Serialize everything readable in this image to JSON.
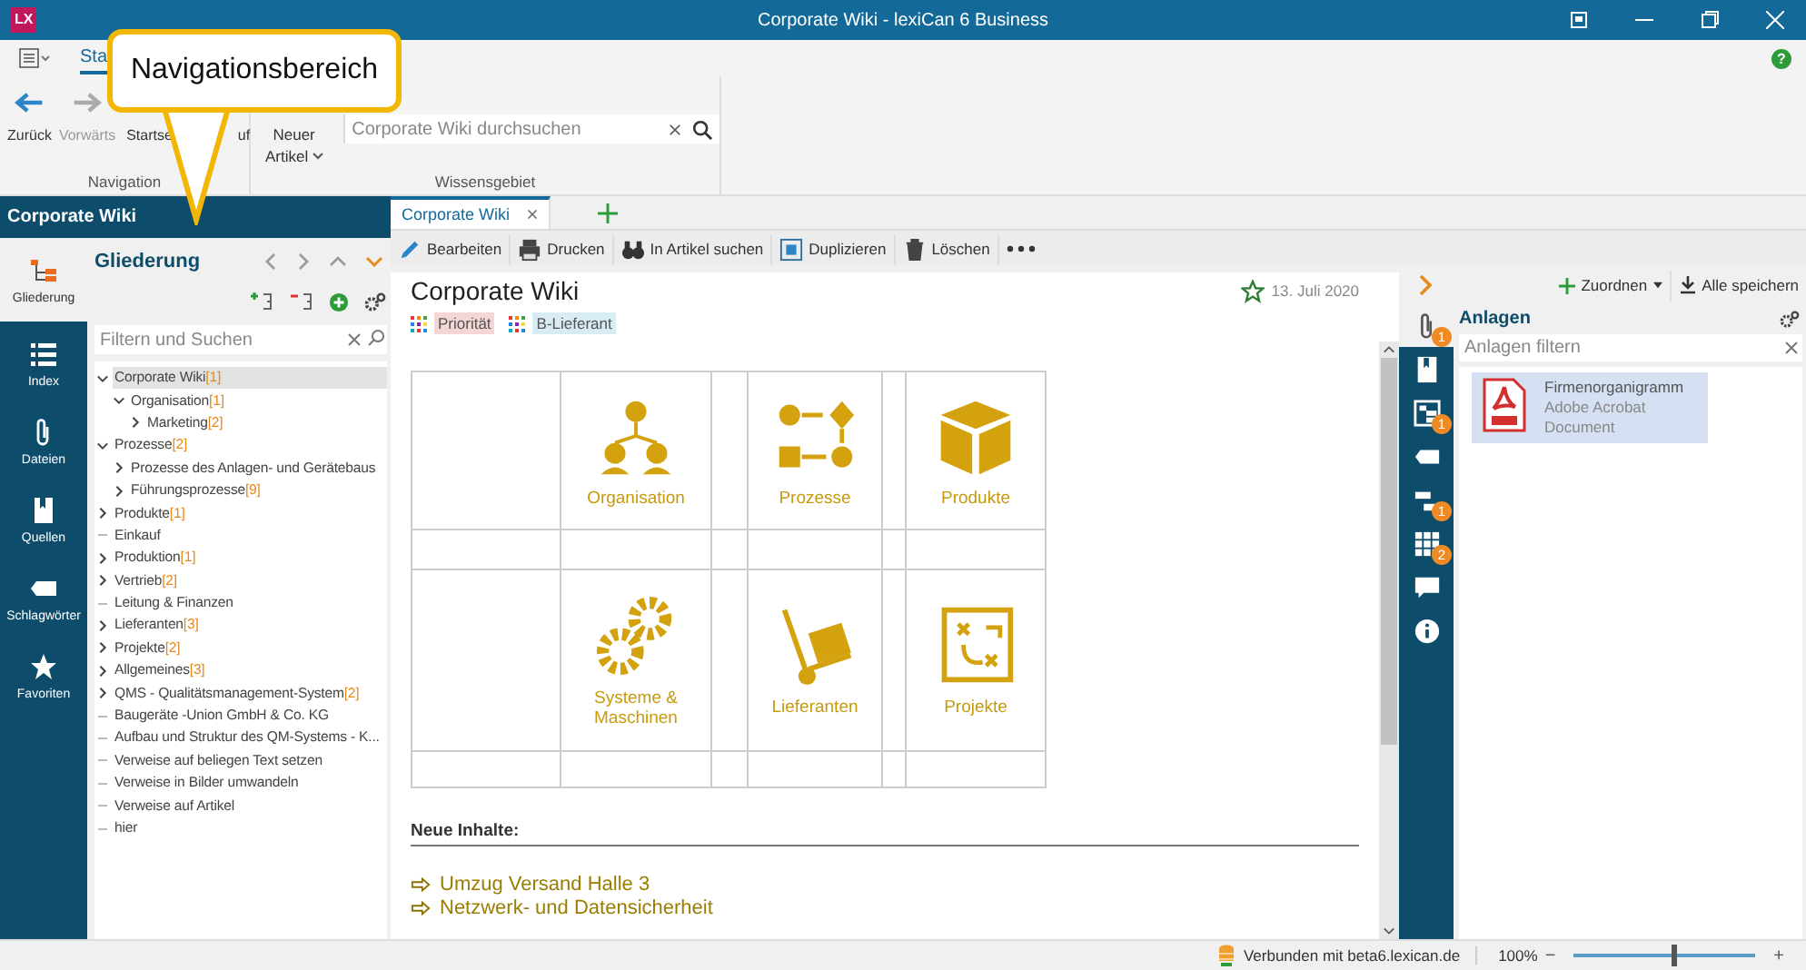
{
  "window": {
    "logo": "LX",
    "title": "Corporate Wiki - lexiCan 6 Business"
  },
  "ribbon": {
    "tabs": [
      {
        "label": "Sta",
        "selected": true
      }
    ],
    "nav_buttons": [
      {
        "kind": "back",
        "label": "Zurück",
        "disabled": false
      },
      {
        "kind": "forward",
        "label": "Vorwärts",
        "disabled": true
      },
      {
        "kind": "home",
        "label": "Startse",
        "disabled": false
      },
      {
        "kind": "history",
        "label": "uf",
        "disabled": false
      }
    ],
    "new_article": {
      "line1": "Neuer",
      "line2": "Artikel"
    },
    "search": {
      "placeholder": "Corporate Wiki durchsuchen"
    },
    "group_labels": [
      "Navigation",
      "Wissensgebiet"
    ],
    "help": "?"
  },
  "callout": {
    "text": "Navigationsbereich"
  },
  "left_panel": {
    "title": "Corporate Wiki",
    "nav": [
      {
        "kind": "outline",
        "label": "Gliederung",
        "selected": true
      },
      {
        "kind": "index",
        "label": "Index",
        "selected": false
      },
      {
        "kind": "files",
        "label": "Dateien",
        "selected": false
      },
      {
        "kind": "sources",
        "label": "Quellen",
        "selected": false
      },
      {
        "kind": "tags",
        "label": "Schlagwörter",
        "selected": false
      },
      {
        "kind": "favorites",
        "label": "Favoriten",
        "selected": false
      }
    ],
    "outline_title": "Gliederung",
    "filter": {
      "placeholder": "Filtern und Suchen"
    },
    "tree": [
      {
        "label": "Corporate Wiki",
        "count": "[1]",
        "selected": true,
        "expanded": true,
        "children": [
          {
            "label": "Organisation",
            "count": "[1]",
            "selected": false,
            "expanded": true,
            "children": [
              {
                "label": "Marketing",
                "count": "[2]",
                "selected": false,
                "expanded": false
              }
            ]
          }
        ]
      },
      {
        "label": "Prozesse",
        "count": "[2]",
        "selected": false,
        "expanded": true,
        "children": [
          {
            "label": "Prozesse des Anlagen- und Gerätebaus",
            "selected": false,
            "expanded": false
          },
          {
            "label": "Führungsprozesse",
            "count": "[9]",
            "selected": false,
            "expanded": false
          }
        ]
      },
      {
        "label": "Produkte",
        "count": "[1]",
        "selected": false,
        "expanded": false
      },
      {
        "label": "Einkauf",
        "selected": false
      },
      {
        "label": "Produktion",
        "count": "[1]",
        "selected": false,
        "expanded": false
      },
      {
        "label": "Vertrieb",
        "count": "[2]",
        "selected": false,
        "expanded": false
      },
      {
        "label": "Leitung & Finanzen",
        "selected": false
      },
      {
        "label": "Lieferanten",
        "count": "[3]",
        "selected": false,
        "expanded": false
      },
      {
        "label": "Projekte",
        "count": "[2]",
        "selected": false,
        "expanded": false
      },
      {
        "label": "Allgemeines",
        "count": "[3]",
        "selected": false,
        "expanded": false
      },
      {
        "label": "QMS - Qualitätsmanagement-System",
        "count": "[2]",
        "selected": false,
        "expanded": false
      },
      {
        "label": "Baugeräte -Union GmbH & Co. KG",
        "selected": false
      },
      {
        "label": "Aufbau und Struktur des QM-Systems - K...",
        "selected": false
      },
      {
        "label": "Verweise auf beliegen Text setzen",
        "selected": false
      },
      {
        "label": "Verweise in Bilder umwandeln",
        "selected": false
      },
      {
        "label": "Verweise auf Artikel",
        "selected": false
      },
      {
        "label": "hier",
        "selected": false
      }
    ]
  },
  "doc_tabs": [
    {
      "label": "Corporate Wiki",
      "selected": true
    }
  ],
  "toolbar": [
    {
      "kind": "edit",
      "label": "Bearbeiten"
    },
    {
      "kind": "print",
      "label": "Drucken"
    },
    {
      "kind": "find",
      "label": "In Artikel suchen"
    },
    {
      "kind": "duplicate",
      "label": "Duplizieren"
    },
    {
      "kind": "delete",
      "label": "Löschen"
    }
  ],
  "article": {
    "title": "Corporate Wiki",
    "date": "13. Juli 2020",
    "tags": [
      {
        "label": "Priorität",
        "color": "#f4d6d6"
      },
      {
        "label": "B-Lieferant",
        "color": "#d7ecf4"
      }
    ],
    "tiles": [
      {
        "kind": "org",
        "label": "Organisation"
      },
      {
        "kind": "process",
        "label": "Prozesse"
      },
      {
        "kind": "box",
        "label": "Produkte"
      },
      {
        "kind": "gears",
        "label": "Systeme & Maschinen"
      },
      {
        "kind": "trolley",
        "label": "Lieferanten"
      },
      {
        "kind": "plan",
        "label": "Projekte"
      }
    ],
    "section_title": "Neue Inhalte:",
    "links": [
      "Umzug Versand Halle 3",
      "Netzwerk- und Datensicherheit"
    ]
  },
  "right_strip": [
    {
      "kind": "attachment",
      "badge": "1",
      "selected": true
    },
    {
      "kind": "source",
      "selected": false
    },
    {
      "kind": "outline",
      "badge": "1",
      "selected": false
    },
    {
      "kind": "tag",
      "selected": false
    },
    {
      "kind": "links",
      "badge": "1",
      "selected": false
    },
    {
      "kind": "grid",
      "badge": "2",
      "selected": false
    },
    {
      "kind": "comment",
      "selected": false
    },
    {
      "kind": "info",
      "selected": false
    }
  ],
  "right_panel": {
    "actions": [
      {
        "kind": "assign",
        "label": "Zuordnen"
      },
      {
        "kind": "save",
        "label": "Alle speichern"
      }
    ],
    "title": "Anlagen",
    "filter": {
      "placeholder": "Anlagen filtern"
    },
    "attachments": [
      {
        "name": "Firmenorganigramm",
        "type": "Adobe Acrobat Document",
        "selected": true
      }
    ]
  },
  "status_bar": {
    "connection": "Verbunden mit beta6.lexican.de",
    "zoom": "100%",
    "minus": "−",
    "zoom_slider": {
      "level": 0.55
    },
    "plus": "+"
  }
}
